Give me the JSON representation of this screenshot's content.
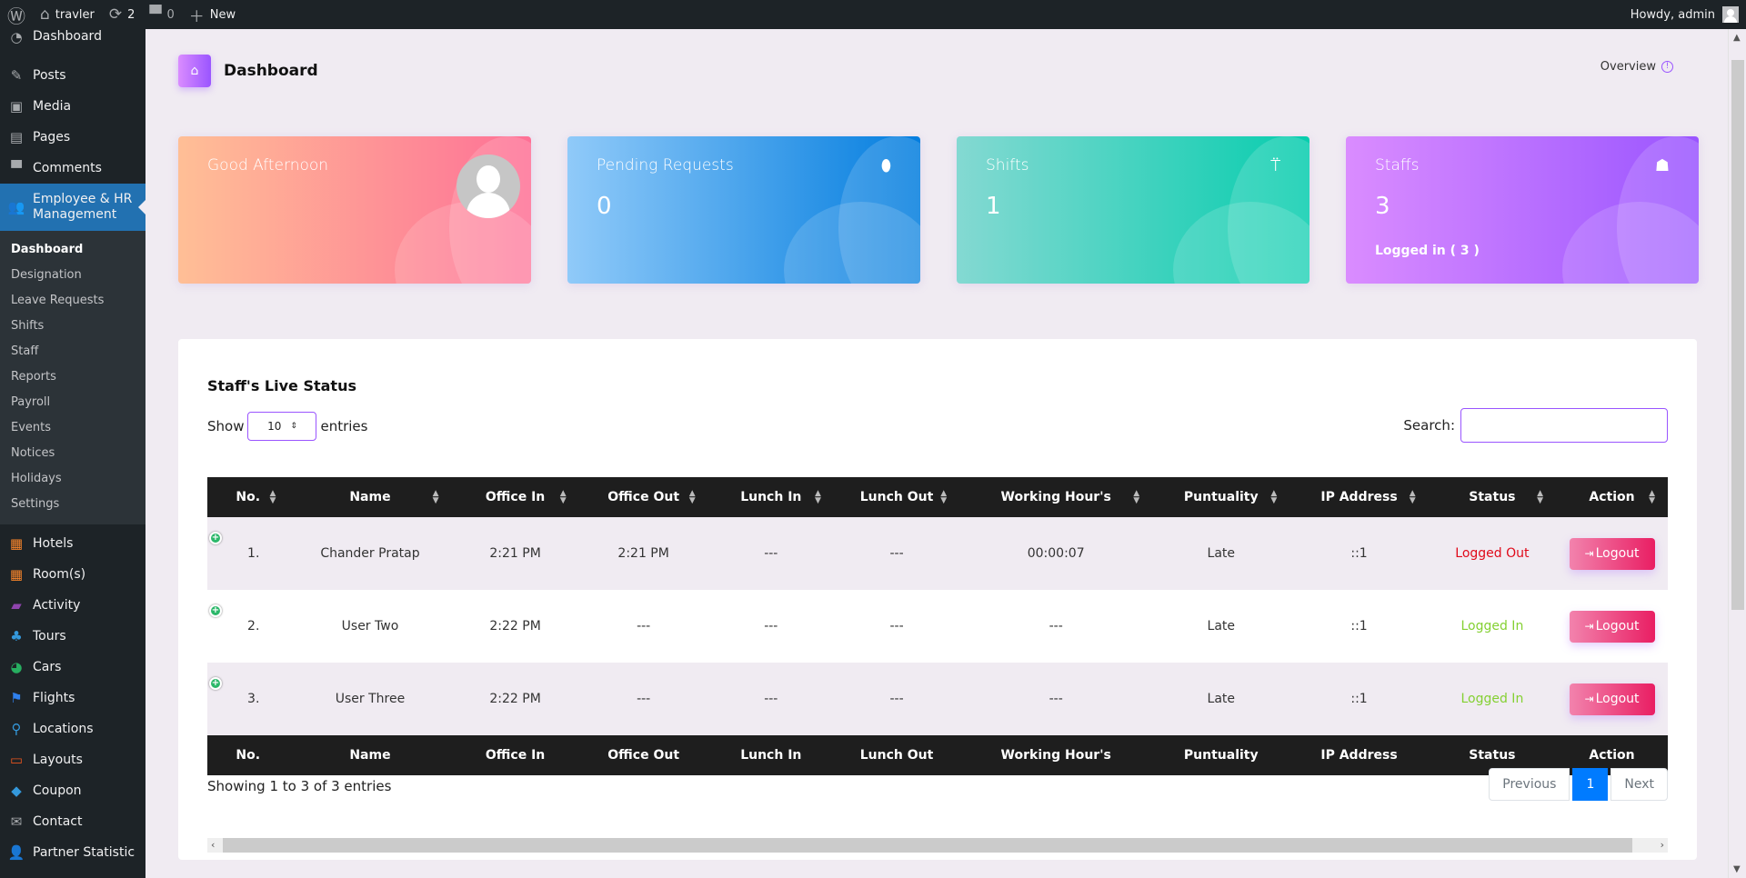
{
  "adminbar": {
    "site_name": "travler",
    "updates_count": "2",
    "comments_count": "0",
    "new_label": "New",
    "greeting": "Howdy, admin"
  },
  "sidebar": {
    "top_items": [
      {
        "label": "Dashboard",
        "icon": "dashboard-icon"
      },
      {
        "label": "Posts",
        "icon": "pin-icon"
      },
      {
        "label": "Media",
        "icon": "media-icon"
      },
      {
        "label": "Pages",
        "icon": "pages-icon"
      },
      {
        "label": "Comments",
        "icon": "comment-icon"
      }
    ],
    "active_item": {
      "label": "Employee & HR Management",
      "icon": "users-icon"
    },
    "submenu": [
      "Dashboard",
      "Designation",
      "Leave Requests",
      "Shifts",
      "Staff",
      "Reports",
      "Payroll",
      "Events",
      "Notices",
      "Holidays",
      "Settings"
    ],
    "bottom_items": [
      {
        "label": "Hotels",
        "icon": "building-icon",
        "color": "#f5832a"
      },
      {
        "label": "Room(s)",
        "icon": "building-icon",
        "color": "#f5832a"
      },
      {
        "label": "Activity",
        "icon": "tickets-icon",
        "color": "#8e44ad"
      },
      {
        "label": "Tours",
        "icon": "palm-tree-icon",
        "color": "#3498db"
      },
      {
        "label": "Cars",
        "icon": "speedometer-icon",
        "color": "#27ae60"
      },
      {
        "label": "Flights",
        "icon": "flag-icon",
        "color": "#2f80ed"
      },
      {
        "label": "Locations",
        "icon": "map-pin-icon",
        "color": "#3498db"
      },
      {
        "label": "Layouts",
        "icon": "monitor-icon",
        "color": "#e8541e"
      },
      {
        "label": "Coupon",
        "icon": "tag-icon",
        "color": "#3498db"
      },
      {
        "label": "Contact",
        "icon": "envelope-icon",
        "color": "#a7aaad"
      },
      {
        "label": "Partner Statistic",
        "icon": "user-icon",
        "color": "#a7aaad"
      }
    ]
  },
  "page": {
    "title": "Dashboard",
    "overview_label": "Overview"
  },
  "cards": [
    {
      "title": "Good Afternoon",
      "value": "",
      "sub": ""
    },
    {
      "title": "Pending Requests",
      "value": "0",
      "sub": ""
    },
    {
      "title": "Shifts",
      "value": "1",
      "sub": ""
    },
    {
      "title": "Staffs",
      "value": "3",
      "sub": "Logged in ( 3 )"
    }
  ],
  "table_panel": {
    "title": "Staff's Live Status",
    "show_label": "Show",
    "entries_label": "entries",
    "page_length": "10",
    "search_label": "Search:",
    "search_value": "",
    "columns": [
      "No.",
      "Name",
      "Office In",
      "Office Out",
      "Lunch In",
      "Lunch Out",
      "Working Hour's",
      "Puntuality",
      "IP Address",
      "Status",
      "Action"
    ],
    "rows": [
      {
        "no": "1.",
        "name": "Chander Pratap",
        "office_in": "2:21 PM",
        "office_out": "2:21 PM",
        "lunch_in": "---",
        "lunch_out": "---",
        "working_hours": "00:00:07",
        "punctuality": "Late",
        "ip": "::1",
        "status": "Logged Out",
        "action": "Logout"
      },
      {
        "no": "2.",
        "name": "User Two",
        "office_in": "2:22 PM",
        "office_out": "---",
        "lunch_in": "---",
        "lunch_out": "---",
        "working_hours": "---",
        "punctuality": "Late",
        "ip": "::1",
        "status": "Logged In",
        "action": "Logout"
      },
      {
        "no": "3.",
        "name": "User Three",
        "office_in": "2:22 PM",
        "office_out": "---",
        "lunch_in": "---",
        "lunch_out": "---",
        "working_hours": "---",
        "punctuality": "Late",
        "ip": "::1",
        "status": "Logged In",
        "action": "Logout"
      }
    ],
    "info": "Showing 1 to 3 of 3 entries",
    "pagination": {
      "previous": "Previous",
      "current": "1",
      "next": "Next"
    }
  },
  "colors": {
    "logged_out": "#e00a1a",
    "logged_in": "#84d032",
    "accent": "#9a55ff",
    "wp_active": "#2271b1"
  }
}
